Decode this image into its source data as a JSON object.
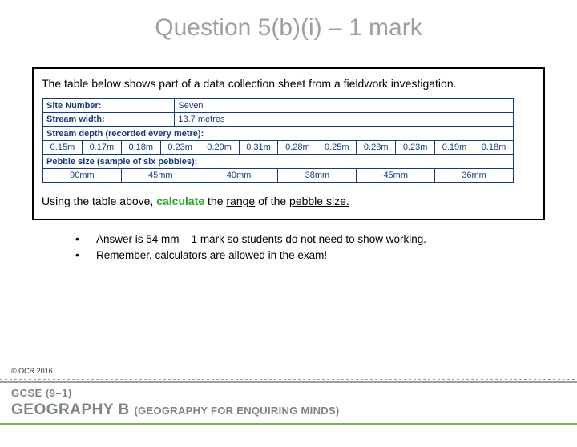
{
  "title": "Question 5(b)(i) – 1 mark",
  "box": {
    "intro": "The table below shows part of a data collection sheet from a fieldwork investigation.",
    "sheet": {
      "site_label": "Site Number:",
      "site_value": "Seven",
      "width_label": "Stream width:",
      "width_value": "13.7 metres",
      "depth_header": "Stream depth (recorded every metre):",
      "depths": [
        "0.15m",
        "0.17m",
        "0.18m",
        "0.23m",
        "0.29m",
        "0.31m",
        "0.28m",
        "0.25m",
        "0.23m",
        "0.23m",
        "0.19m",
        "0.18m"
      ],
      "pebble_header": "Pebble size (sample of six pebbles):",
      "pebbles": [
        "90mm",
        "45mm",
        "40mm",
        "38mm",
        "45mm",
        "36mm"
      ]
    },
    "instruction_prefix": "Using the table above, ",
    "instruction_calc": "calculate",
    "instruction_mid": " the ",
    "instruction_range": "range",
    "instruction_mid2": " of the ",
    "instruction_pebble": "pebble size.",
    "instruction_suffix": ""
  },
  "notes": {
    "b1_pre": "Answer is ",
    "b1_ans": "54 mm",
    "b1_post": " – 1 mark so students do not need to show working.",
    "b2": "Remember, calculators are allowed in the exam!"
  },
  "footer": {
    "copyright": "© OCR 2016",
    "gcse": "GCSE (9–1)",
    "subject_main": "GEOGRAPHY B ",
    "subject_sub": "(GEOGRAPHY FOR ENQUIRING MINDS)"
  }
}
